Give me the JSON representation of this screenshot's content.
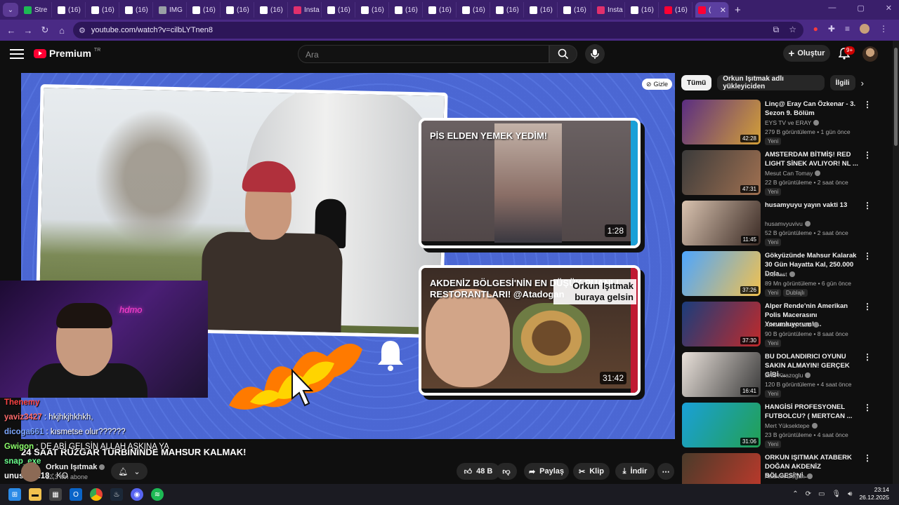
{
  "browser": {
    "tabs": [
      {
        "label": "Stre",
        "color": "#1db954",
        "icon": "kick-icon"
      },
      {
        "label": "(16)",
        "color": "#ffffff",
        "icon": "x-icon"
      },
      {
        "label": "(16)",
        "color": "#ffffff",
        "icon": "x-icon"
      },
      {
        "label": "(16)",
        "color": "#ffffff",
        "icon": "x-icon"
      },
      {
        "label": "IMG",
        "color": "#9aa0a6",
        "icon": "globe-icon"
      },
      {
        "label": "(16)",
        "color": "#ffffff",
        "icon": "x-icon"
      },
      {
        "label": "(16)",
        "color": "#ffffff",
        "icon": "x-icon"
      },
      {
        "label": "(16)",
        "color": "#ffffff",
        "icon": "x-icon"
      },
      {
        "label": "Insta",
        "color": "#e1306c",
        "icon": "instagram-icon"
      },
      {
        "label": "(16)",
        "color": "#ffffff",
        "icon": "x-icon"
      },
      {
        "label": "(16)",
        "color": "#ffffff",
        "icon": "x-icon"
      },
      {
        "label": "(16)",
        "color": "#ffffff",
        "icon": "x-icon"
      },
      {
        "label": "(16)",
        "color": "#ffffff",
        "icon": "x-icon"
      },
      {
        "label": "(16)",
        "color": "#ffffff",
        "icon": "x-icon"
      },
      {
        "label": "(16)",
        "color": "#ffffff",
        "icon": "x-icon"
      },
      {
        "label": "(16)",
        "color": "#ffffff",
        "icon": "x-icon"
      },
      {
        "label": "(16)",
        "color": "#ffffff",
        "icon": "x-icon"
      },
      {
        "label": "Insta",
        "color": "#e1306c",
        "icon": "instagram-icon"
      },
      {
        "label": "(16)",
        "color": "#ffffff",
        "icon": "x-icon"
      },
      {
        "label": "(16)",
        "color": "#ff0033",
        "icon": "youtube-icon"
      },
      {
        "label": "(",
        "color": "#ff0033",
        "icon": "youtube-icon",
        "active": true
      }
    ],
    "url": "youtube.com/watch?v=cilbLYTnen8"
  },
  "header": {
    "logo_word": "Premium",
    "logo_region": "TR",
    "search_placeholder": "Ara",
    "create_label": "Oluştur",
    "notif_badge": "9+"
  },
  "player": {
    "hide_label": "Gizle",
    "card1": {
      "title": "PİS ELDEN YEMEK YEDİM!",
      "duration": "1:28"
    },
    "card2": {
      "title": "AKDENİZ BÖLGESİ'NİN EN DÜŞÜK PUANLI RESTORANTLARI! @Atadogan",
      "duration": "31:42"
    },
    "overlay_text": "Orkun Işıtmak buraya gelsin",
    "cam_neon": "hdmo"
  },
  "video": {
    "title": "24 SAAT RÜZGAR TÜRBİNİNDE MAHSUR KALMAK!",
    "channel": "Orkun Işıtmak",
    "subs": "12,3 Mn abone"
  },
  "chat": [
    {
      "user": "Thenemy",
      "text": "",
      "color": "#ff4444"
    },
    {
      "user": "yaviz3427",
      "text": ": hkjhkjhkhkh,",
      "color": "#ff6b6b"
    },
    {
      "user": "dicoga661",
      "text": ": kısmetse olur??????",
      "color": "#7ea8ff"
    },
    {
      "user": "Gwigon",
      "text": ": DE ABİ GELSİN ALLAH AŞKINA YA",
      "color": "#8dff6b"
    },
    {
      "user": "snap_exe",
      "text": "",
      "color": "#6bff8d"
    },
    {
      "user": "unusmire18",
      "text": ": KO",
      "color": "#ffffff"
    }
  ],
  "actions": {
    "likes": "48 B",
    "share": "Paylaş",
    "clip": "Klip",
    "download": "İndir"
  },
  "sidebar": {
    "chips": [
      "Tümü",
      "Orkun Işıtmak adlı yükleyiciden",
      "İlgili"
    ],
    "recs": [
      {
        "title": "Linç@ Eray Can Özkenar - 3. Sezon 9. Bölüm",
        "channel": "EYS TV ve ERAY",
        "meta": "279 B görüntüleme • 1 gün önce",
        "tag": "Yeni",
        "dur": "42:28",
        "c1": "#5a2d82",
        "c2": "#d4a037"
      },
      {
        "title": "AMSTERDAM BİTMİŞ! RED LIGHT SİNEK AVLIYOR! NL ...",
        "channel": "Mesut Can Tomay",
        "meta": "22 B görüntüleme • 2 saat önce",
        "tag": "Yeni",
        "dur": "47:31",
        "c1": "#3b3b3b",
        "c2": "#a07050"
      },
      {
        "title": "husamyuyu yayın vakti 13",
        "channel": "husamvyuvivu",
        "meta": "52 B görüntüleme • 2 saat önce",
        "tag": "Yeni",
        "dur": "11:45",
        "c1": "#d9c3b0",
        "c2": "#3a2a24"
      },
      {
        "title": "Gökyüzünde Mahsur Kalarak 30 Gün Hayatta Kal, 250.000 Dola...",
        "channel": "MrBeast",
        "meta": "89 Mn görüntüleme • 6 gün önce",
        "tag": "Yeni",
        "tag2": "Dublajlı",
        "dur": "37:26",
        "c1": "#4da6ff",
        "c2": "#f2c14e"
      },
      {
        "title": "Alper Rende'nin Amerikan Polis Macerasını Yorumluyorum! ...",
        "channel": "Amerikali Aynasiz",
        "meta": "90 B görüntüleme • 8 saat önce",
        "tag": "Yeni",
        "dur": "37:30",
        "c1": "#1a3d7c",
        "c2": "#c02a2a"
      },
      {
        "title": "BU DOLANDIRICI OYUNU SAKIN ALMAYIN! GERÇEK GİBİ ...",
        "channel": "Enis Kirazoglu",
        "meta": "120 B görüntüleme • 4 saat önce",
        "tag": "Yeni",
        "dur": "16:41",
        "c1": "#e9e1da",
        "c2": "#3a3a3a"
      },
      {
        "title": "HANGİSİ PROFESYONEL FUTBOLCU? ( MERTCAN ...",
        "channel": "Mert Yüksektepe",
        "meta": "23 B görüntüleme • 4 saat önce",
        "tag": "Yeni",
        "dur": "31:06",
        "c1": "#1aa0d8",
        "c2": "#22a052"
      },
      {
        "title": "ORKUN IŞITMAK ATABERK DOĞAN AKDENİZ BÖLGESİ'Nİ...",
        "channel": "Ataberk Doğan",
        "meta": "",
        "tag": "",
        "dur": "",
        "c1": "#4a3b2a",
        "c2": "#c0392b"
      }
    ]
  },
  "taskbar": {
    "time": "23:14",
    "date": "26.12.2025"
  }
}
